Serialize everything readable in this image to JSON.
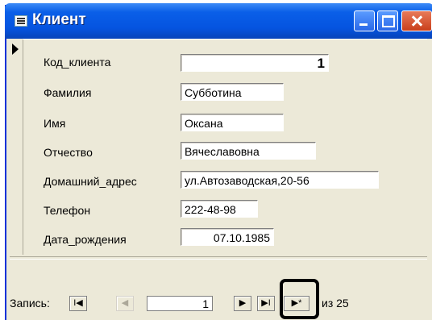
{
  "window": {
    "title": "Клиент",
    "icon": "form-icon",
    "controls": [
      "minimize-icon",
      "maximize-icon",
      "close-icon"
    ]
  },
  "form": {
    "fields": [
      {
        "label": "Код_клиента",
        "value": "1"
      },
      {
        "label": "Фамилия",
        "value": "Субботина"
      },
      {
        "label": "Имя",
        "value": "Оксана"
      },
      {
        "label": "Отчество",
        "value": "Вячеславовна"
      },
      {
        "label": "Домашний_адрес",
        "value": "ул.Автозаводская,20-56"
      },
      {
        "label": "Телефон",
        "value": "222-48-98"
      },
      {
        "label": "Дата_рождения",
        "value": "07.10.1985"
      }
    ]
  },
  "navigation": {
    "label": "Запись:",
    "first_glyph": "I◀",
    "prev_glyph": "◀",
    "current": "1",
    "next_glyph": "▶",
    "last_glyph": "▶I",
    "new_glyph": "▶*",
    "of_text": "из 25"
  }
}
